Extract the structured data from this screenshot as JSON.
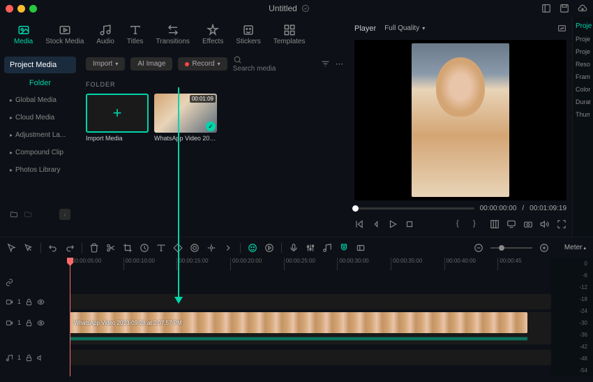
{
  "titlebar": {
    "title": "Untitled"
  },
  "tabs": [
    {
      "label": "Media",
      "active": true
    },
    {
      "label": "Stock Media"
    },
    {
      "label": "Audio"
    },
    {
      "label": "Titles"
    },
    {
      "label": "Transitions"
    },
    {
      "label": "Effects"
    },
    {
      "label": "Stickers"
    },
    {
      "label": "Templates"
    }
  ],
  "sidebar": {
    "project_media": "Project Media",
    "folder": "Folder",
    "items": [
      "Global Media",
      "Cloud Media",
      "Adjustment La...",
      "Compound Clip",
      "Photos Library"
    ]
  },
  "toolbar": {
    "import": "Import",
    "ai_image": "AI Image",
    "record": "Record",
    "search_placeholder": "Search media"
  },
  "folder_label": "FOLDER",
  "thumbs": {
    "import": "Import Media",
    "video": {
      "duration": "00:01:09",
      "label": "WhatsApp Video 202..."
    }
  },
  "player": {
    "label": "Player",
    "quality": "Full Quality",
    "current": "00:00:00:00",
    "sep": "/",
    "total": "00:01:09:19"
  },
  "props": {
    "title": "Proje",
    "rows": [
      "Proje",
      "Proje Locat",
      "Reso",
      "Fram",
      "Color",
      "Durat",
      "Thum"
    ]
  },
  "ruler": [
    "00:00:05:00",
    "00:00:10:00",
    "00:00:15:00",
    "00:00:20:00",
    "00:00:25:00",
    "00:00:30:00",
    "00:00:35:00",
    "00:00:40:00",
    "00:00:45"
  ],
  "clip_label": "WhatsApp Video 2023-09-28 at 2.07.57 PM",
  "meter": {
    "label": "Meter",
    "scale": [
      "0",
      "-6",
      "-12",
      "-18",
      "-24",
      "-30",
      "-36",
      "-42",
      "-48",
      "-54"
    ]
  },
  "track_icons": [
    "1",
    "1",
    "1"
  ]
}
